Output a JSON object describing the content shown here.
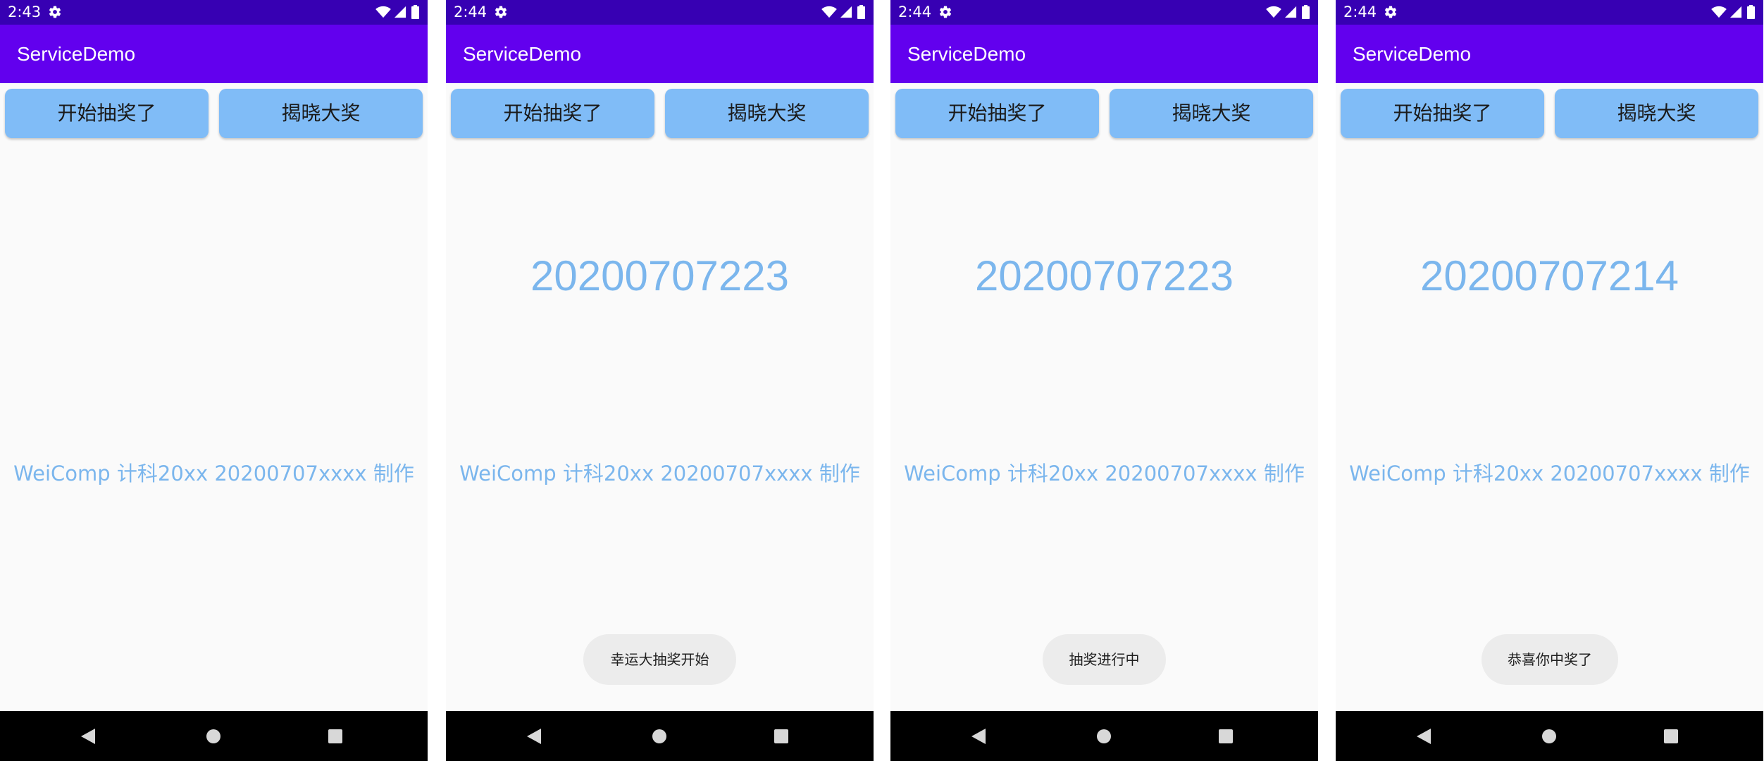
{
  "app": {
    "title": "ServiceDemo",
    "buttons": {
      "start_label": "开始抽奖了",
      "reveal_label": "揭晓大奖"
    },
    "credit": "WeiComp 计科20xx 20200707xxxx 制作"
  },
  "colors": {
    "status_bar": "#3700b3",
    "app_bar": "#6200ee",
    "button_bg": "#80bcf7",
    "accent_text": "#7bb6ed",
    "background": "#fafafa",
    "toast_bg": "#ececec",
    "nav_bar": "#000000"
  },
  "icons": {
    "status": [
      "gear-icon",
      "wifi-icon",
      "signal-icon",
      "battery-icon"
    ],
    "navigation": [
      "back-icon",
      "home-icon",
      "recents-icon"
    ]
  },
  "screens": [
    {
      "time": "2:43",
      "number": "",
      "toast": ""
    },
    {
      "time": "2:44",
      "number": "20200707223",
      "toast": "幸运大抽奖开始"
    },
    {
      "time": "2:44",
      "number": "20200707223",
      "toast": "抽奖进行中"
    },
    {
      "time": "2:44",
      "number": "20200707214",
      "toast": "恭喜你中奖了"
    }
  ]
}
